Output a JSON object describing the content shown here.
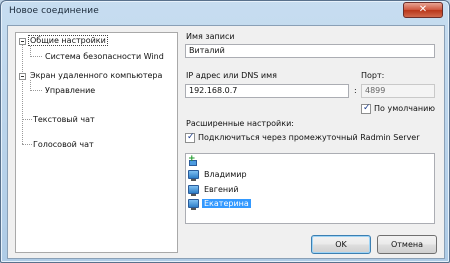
{
  "window": {
    "title": "Новое соединение"
  },
  "tree": {
    "items": [
      {
        "label": "Общие настройки",
        "level": 0,
        "expanded": true
      },
      {
        "label": "Система безопасности Wind",
        "level": 1
      },
      {
        "label": "Экран удаленного компьютера",
        "level": 0,
        "expanded": true
      },
      {
        "label": "Управление",
        "level": 1
      },
      {
        "label": "Текстовый чат",
        "level": 0
      },
      {
        "label": "Голосовой чат",
        "level": 0
      }
    ]
  },
  "form": {
    "record_name_label": "Имя записи",
    "record_name_value": "Виталий",
    "ip_label": "IP адрес или DNS имя",
    "ip_value": "192.168.0.7",
    "port_label": "Порт:",
    "port_value": "4899",
    "port_separator": ":",
    "default_label": "По умолчанию",
    "default_checked": true,
    "advanced_label": "Расширенные настройки:",
    "proxy_label": "Подключиться через промежуточный Radmin Server",
    "proxy_checked": true
  },
  "proxy_list": {
    "items": [
      {
        "label": "Владимир",
        "selected": false
      },
      {
        "label": "Евгений",
        "selected": false
      },
      {
        "label": "Екатерина",
        "selected": true
      }
    ]
  },
  "buttons": {
    "ok": "OK",
    "cancel": "Отмена"
  }
}
